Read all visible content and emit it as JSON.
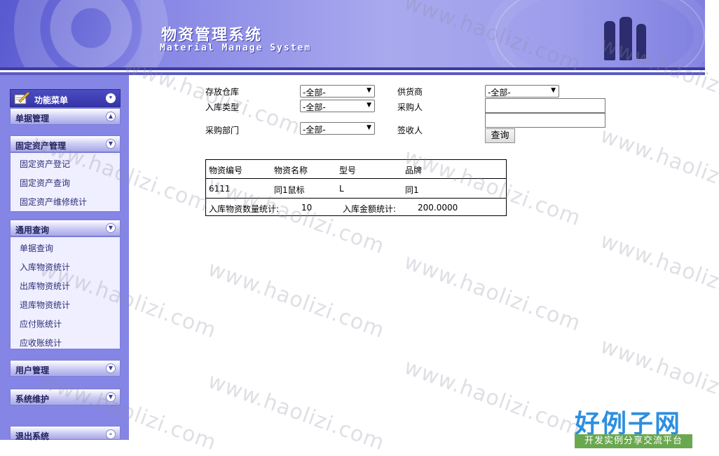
{
  "header": {
    "title": "物资管理系统",
    "subtitle": "Material Manage System"
  },
  "sidebar": {
    "menu_title": "功能菜单",
    "sections": [
      {
        "label": "单据管理",
        "state": "collapsed"
      },
      {
        "label": "固定资产管理",
        "state": "expanded",
        "items": [
          "固定资产登记",
          "固定资产查询",
          "固定资产维修统计"
        ]
      },
      {
        "label": "通用查询",
        "state": "expanded",
        "items": [
          "单据查询",
          "入库物资统计",
          "出库物资统计",
          "退库物资统计",
          "应付账统计",
          "应收账统计"
        ]
      },
      {
        "label": "用户管理",
        "state": "collapsed"
      },
      {
        "label": "系统维护",
        "state": "collapsed"
      },
      {
        "label": "退出系统",
        "state": "collapsed"
      }
    ]
  },
  "form": {
    "warehouse_label": "存放仓库",
    "warehouse_value": "-全部-",
    "supplier_label": "供货商",
    "supplier_value": "-全部-",
    "stock_type_label": "入库类型",
    "stock_type_value": "-全部-",
    "buyer_label": "采购人",
    "buyer_value": "",
    "dept_label": "采购部门",
    "dept_value": "-全部-",
    "receiver_label": "签收人",
    "receiver_value": "",
    "query_button": "查询"
  },
  "table": {
    "headers": [
      "物资编号",
      "物资名称",
      "型号",
      "品牌"
    ],
    "rows": [
      [
        "6111",
        "同1鼠标",
        "L",
        "同1"
      ]
    ],
    "summary": {
      "qty_label": "入库物资数量统计:",
      "qty_value": "10",
      "amount_label": "入库金额统计:",
      "amount_value": "200.0000"
    }
  },
  "watermark": "www.haolizi.com",
  "logo": {
    "main": "好例子网",
    "tagline": "开发实例分享交流平台"
  },
  "colors": {
    "banner": "#8a8ae6",
    "sidebar": "#8585e6",
    "menu_title": "#3535a8",
    "logo_blue": "#2d8fe0",
    "logo_green": "#6aa84f"
  }
}
